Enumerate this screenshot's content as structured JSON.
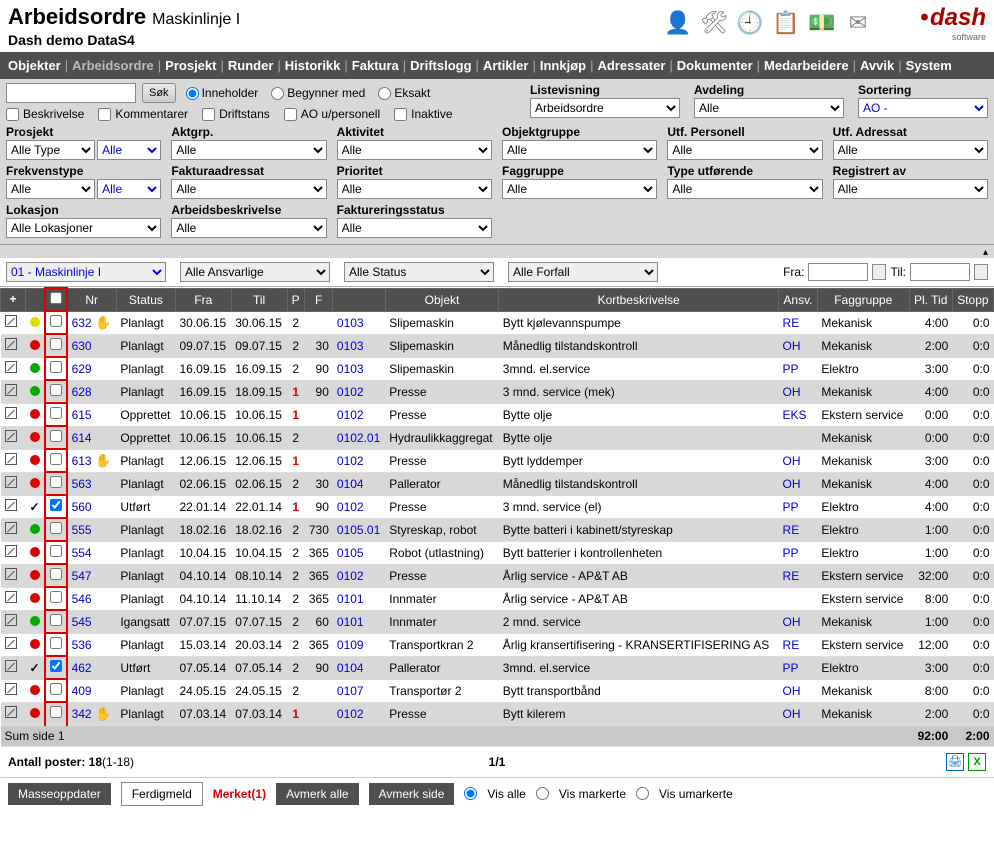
{
  "header": {
    "title": "Arbeidsordre",
    "subtitle": "Maskinlinje I",
    "line2": "Dash demo DataS4",
    "logo": "dash",
    "logo_sub": "software"
  },
  "nav": [
    "Objekter",
    "Arbeidsordre",
    "Prosjekt",
    "Runder",
    "Historikk",
    "Faktura",
    "Driftslogg",
    "Artikler",
    "Innkjøp",
    "Adressater",
    "Dokumenter",
    "Medarbeidere",
    "Avvik",
    "System"
  ],
  "nav_active_index": 1,
  "search": {
    "btn": "Søk",
    "radios": [
      "Inneholder",
      "Begynner med",
      "Eksakt"
    ],
    "radio_checked": 0
  },
  "checks": [
    "Beskrivelse",
    "Kommentarer",
    "Driftstans",
    "AO u/personell",
    "Inaktive"
  ],
  "top_filters": {
    "listevisning": {
      "label": "Listevisning",
      "value": "Arbeidsordre"
    },
    "avdeling": {
      "label": "Avdeling",
      "value": "Alle"
    },
    "sortering": {
      "label": "Sortering",
      "value": "AO -"
    }
  },
  "filters": [
    {
      "label": "Prosjekt",
      "pair": [
        "Alle Type",
        "Alle"
      ],
      "blue": [
        false,
        true
      ]
    },
    {
      "label": "Aktgrp.",
      "value": "Alle"
    },
    {
      "label": "Aktivitet",
      "value": "Alle"
    },
    {
      "label": "Objektgruppe",
      "value": "Alle"
    },
    {
      "label": "Utf. Personell",
      "value": "Alle"
    },
    {
      "label": "Utf. Adressat",
      "value": "Alle"
    },
    {
      "label": "Frekvenstype",
      "pair": [
        "Alle",
        "Alle"
      ],
      "blue": [
        false,
        true
      ]
    },
    {
      "label": "Fakturaadressat",
      "value": "Alle"
    },
    {
      "label": "Prioritet",
      "value": "Alle"
    },
    {
      "label": "Faggruppe",
      "value": "Alle"
    },
    {
      "label": "Type utførende",
      "value": "Alle"
    },
    {
      "label": "Registrert av",
      "value": "Alle"
    },
    {
      "label": "Lokasjon",
      "value": "Alle Lokasjoner"
    },
    {
      "label": "Arbeidsbeskrivelse",
      "value": "Alle"
    },
    {
      "label": "Faktureringsstatus",
      "value": "Alle"
    }
  ],
  "subfilter": {
    "sel1": "01 - Maskinlinje I",
    "sel2": "Alle Ansvarlige",
    "sel3": "Alle Status",
    "sel4": "Alle Forfall",
    "fra": "Fra:",
    "til": "Til:"
  },
  "columns": [
    "",
    "",
    "",
    "Nr",
    "Status",
    "Fra",
    "Til",
    "P",
    "F",
    "",
    "Objekt",
    "Kortbeskrivelse",
    "Ansv.",
    "Faggruppe",
    "Pl. Tid",
    "Stopp"
  ],
  "rows": [
    {
      "shade": false,
      "dot": "yellow",
      "tick": "",
      "chk": false,
      "nr": "632",
      "hand": true,
      "status": "Planlagt",
      "fra": "30.06.15",
      "til": "30.06.15",
      "p": "2",
      "pred": false,
      "f": "",
      "obj": "0103",
      "objtxt": "Slipemaskin",
      "kort": "Bytt kjølevannspumpe",
      "ansv": "RE",
      "fag": "Mekanisk",
      "tid": "4:00",
      "stopp": "0:0"
    },
    {
      "shade": true,
      "dot": "red",
      "tick": "",
      "chk": false,
      "nr": "630",
      "hand": false,
      "status": "Planlagt",
      "fra": "09.07.15",
      "til": "09.07.15",
      "p": "2",
      "pred": false,
      "f": "30",
      "obj": "0103",
      "objtxt": "Slipemaskin",
      "kort": "Månedlig tilstandskontroll",
      "ansv": "OH",
      "fag": "Mekanisk",
      "tid": "2:00",
      "stopp": "0:0"
    },
    {
      "shade": false,
      "dot": "green",
      "tick": "",
      "chk": false,
      "nr": "629",
      "hand": false,
      "status": "Planlagt",
      "fra": "16.09.15",
      "til": "16.09.15",
      "p": "2",
      "pred": false,
      "f": "90",
      "obj": "0103",
      "objtxt": "Slipemaskin",
      "kort": "3mnd. el.service",
      "ansv": "PP",
      "fag": "Elektro",
      "tid": "3:00",
      "stopp": "0:0"
    },
    {
      "shade": true,
      "dot": "green",
      "tick": "",
      "chk": false,
      "nr": "628",
      "hand": false,
      "status": "Planlagt",
      "fra": "16.09.15",
      "til": "18.09.15",
      "p": "1",
      "pred": true,
      "f": "90",
      "obj": "0102",
      "objtxt": "Presse",
      "kort": "3 mnd. service (mek)",
      "ansv": "OH",
      "fag": "Mekanisk",
      "tid": "4:00",
      "stopp": "0:0"
    },
    {
      "shade": false,
      "dot": "red",
      "tick": "",
      "chk": false,
      "nr": "615",
      "hand": false,
      "status": "Opprettet",
      "fra": "10.06.15",
      "til": "10.06.15",
      "p": "1",
      "pred": true,
      "f": "",
      "obj": "0102",
      "objtxt": "Presse",
      "kort": "Bytte olje",
      "ansv": "EKS",
      "fag": "Ekstern service",
      "tid": "0:00",
      "stopp": "0:0"
    },
    {
      "shade": true,
      "dot": "red",
      "tick": "",
      "chk": false,
      "nr": "614",
      "hand": false,
      "status": "Opprettet",
      "fra": "10.06.15",
      "til": "10.06.15",
      "p": "2",
      "pred": false,
      "f": "",
      "obj": "0102.01",
      "objtxt": "Hydraulikkaggregat",
      "kort": "Bytte olje",
      "ansv": "",
      "fag": "Mekanisk",
      "tid": "0:00",
      "stopp": "0:0"
    },
    {
      "shade": false,
      "dot": "red",
      "tick": "",
      "chk": false,
      "nr": "613",
      "hand": true,
      "status": "Planlagt",
      "fra": "12.06.15",
      "til": "12.06.15",
      "p": "1",
      "pred": true,
      "f": "",
      "obj": "0102",
      "objtxt": "Presse",
      "kort": "Bytt lyddemper",
      "ansv": "OH",
      "fag": "Mekanisk",
      "tid": "3:00",
      "stopp": "0:0"
    },
    {
      "shade": true,
      "dot": "red",
      "tick": "",
      "chk": false,
      "nr": "563",
      "hand": false,
      "status": "Planlagt",
      "fra": "02.06.15",
      "til": "02.06.15",
      "p": "2",
      "pred": false,
      "f": "30",
      "obj": "0104",
      "objtxt": "Pallerator",
      "kort": "Månedlig tilstandskontroll",
      "ansv": "OH",
      "fag": "Mekanisk",
      "tid": "4:00",
      "stopp": "0:0"
    },
    {
      "shade": false,
      "dot": "",
      "tick": "✓",
      "chk": true,
      "nr": "560",
      "hand": false,
      "status": "Utført",
      "fra": "22.01.14",
      "til": "22.01.14",
      "p": "1",
      "pred": true,
      "f": "90",
      "obj": "0102",
      "objtxt": "Presse",
      "kort": "3 mnd. service (el)",
      "ansv": "PP",
      "fag": "Elektro",
      "tid": "4:00",
      "stopp": "0:0"
    },
    {
      "shade": true,
      "dot": "green",
      "tick": "",
      "chk": false,
      "nr": "555",
      "hand": false,
      "status": "Planlagt",
      "fra": "18.02.16",
      "til": "18.02.16",
      "p": "2",
      "pred": false,
      "f": "730",
      "obj": "0105.01",
      "objtxt": "Styreskap, robot",
      "kort": "Bytte batteri i kabinett/styreskap",
      "ansv": "RE",
      "fag": "Elektro",
      "tid": "1:00",
      "stopp": "0:0"
    },
    {
      "shade": false,
      "dot": "red",
      "tick": "",
      "chk": false,
      "nr": "554",
      "hand": false,
      "status": "Planlagt",
      "fra": "10.04.15",
      "til": "10.04.15",
      "p": "2",
      "pred": false,
      "f": "365",
      "obj": "0105",
      "objtxt": "Robot (utlastning)",
      "kort": "Bytt batterier i kontrollenheten",
      "ansv": "PP",
      "fag": "Elektro",
      "tid": "1:00",
      "stopp": "0:0"
    },
    {
      "shade": true,
      "dot": "red",
      "tick": "",
      "chk": false,
      "nr": "547",
      "hand": false,
      "status": "Planlagt",
      "fra": "04.10.14",
      "til": "08.10.14",
      "p": "2",
      "pred": false,
      "f": "365",
      "obj": "0102",
      "objtxt": "Presse",
      "kort": "Årlig service - AP&T AB",
      "ansv": "RE",
      "fag": "Ekstern service",
      "tid": "32:00",
      "stopp": "0:0"
    },
    {
      "shade": false,
      "dot": "red",
      "tick": "",
      "chk": false,
      "nr": "546",
      "hand": false,
      "status": "Planlagt",
      "fra": "04.10.14",
      "til": "11.10.14",
      "p": "2",
      "pred": false,
      "f": "365",
      "obj": "0101",
      "objtxt": "Innmater",
      "kort": "Årlig service - AP&T AB",
      "ansv": "",
      "fag": "Ekstern service",
      "tid": "8:00",
      "stopp": "0:0"
    },
    {
      "shade": true,
      "dot": "green",
      "tick": "",
      "chk": false,
      "nr": "545",
      "hand": false,
      "status": "Igangsatt",
      "fra": "07.07.15",
      "til": "07.07.15",
      "p": "2",
      "pred": false,
      "f": "60",
      "obj": "0101",
      "objtxt": "Innmater",
      "kort": "2 mnd. service",
      "ansv": "OH",
      "fag": "Mekanisk",
      "tid": "1:00",
      "stopp": "0:0"
    },
    {
      "shade": false,
      "dot": "red",
      "tick": "",
      "chk": false,
      "nr": "536",
      "hand": false,
      "status": "Planlagt",
      "fra": "15.03.14",
      "til": "20.03.14",
      "p": "2",
      "pred": false,
      "f": "365",
      "obj": "0109",
      "objtxt": "Transportkran 2",
      "kort": "Årlig kransertifisering - KRANSERTIFISERING AS",
      "ansv": "RE",
      "fag": "Ekstern service",
      "tid": "12:00",
      "stopp": "0:0"
    },
    {
      "shade": true,
      "dot": "",
      "tick": "✓",
      "chk": true,
      "nr": "462",
      "hand": false,
      "status": "Utført",
      "fra": "07.05.14",
      "til": "07.05.14",
      "p": "2",
      "pred": false,
      "f": "90",
      "obj": "0104",
      "objtxt": "Pallerator",
      "kort": "3mnd. el.service",
      "ansv": "PP",
      "fag": "Elektro",
      "tid": "3:00",
      "stopp": "0:0"
    },
    {
      "shade": false,
      "dot": "red",
      "tick": "",
      "chk": false,
      "nr": "409",
      "hand": false,
      "status": "Planlagt",
      "fra": "24.05.15",
      "til": "24.05.15",
      "p": "2",
      "pred": false,
      "f": "",
      "obj": "0107",
      "objtxt": "Transportør 2",
      "kort": "Bytt transportbånd",
      "ansv": "OH",
      "fag": "Mekanisk",
      "tid": "8:00",
      "stopp": "0:0"
    },
    {
      "shade": true,
      "dot": "red",
      "tick": "",
      "chk": false,
      "nr": "342",
      "hand": true,
      "status": "Planlagt",
      "fra": "07.03.14",
      "til": "07.03.14",
      "p": "1",
      "pred": true,
      "f": "",
      "obj": "0102",
      "objtxt": "Presse",
      "kort": "Bytt kilerem",
      "ansv": "OH",
      "fag": "Mekanisk",
      "tid": "2:00",
      "stopp": "0:0"
    }
  ],
  "sum": {
    "label": "Sum side 1",
    "tid": "92:00",
    "stopp": "2:00"
  },
  "footer": {
    "antall_label": "Antall poster: ",
    "antall_bold": "18",
    "antall_suffix": "(1-18)",
    "page": "1/1"
  },
  "buttons": {
    "masse": "Masseoppdater",
    "ferdig": "Ferdigmeld",
    "merket": "Merket(1)",
    "avmerk_alle": "Avmerk alle",
    "avmerk_side": "Avmerk side"
  },
  "vis_radios": [
    "Vis alle",
    "Vis markerte",
    "Vis umarkerte"
  ]
}
